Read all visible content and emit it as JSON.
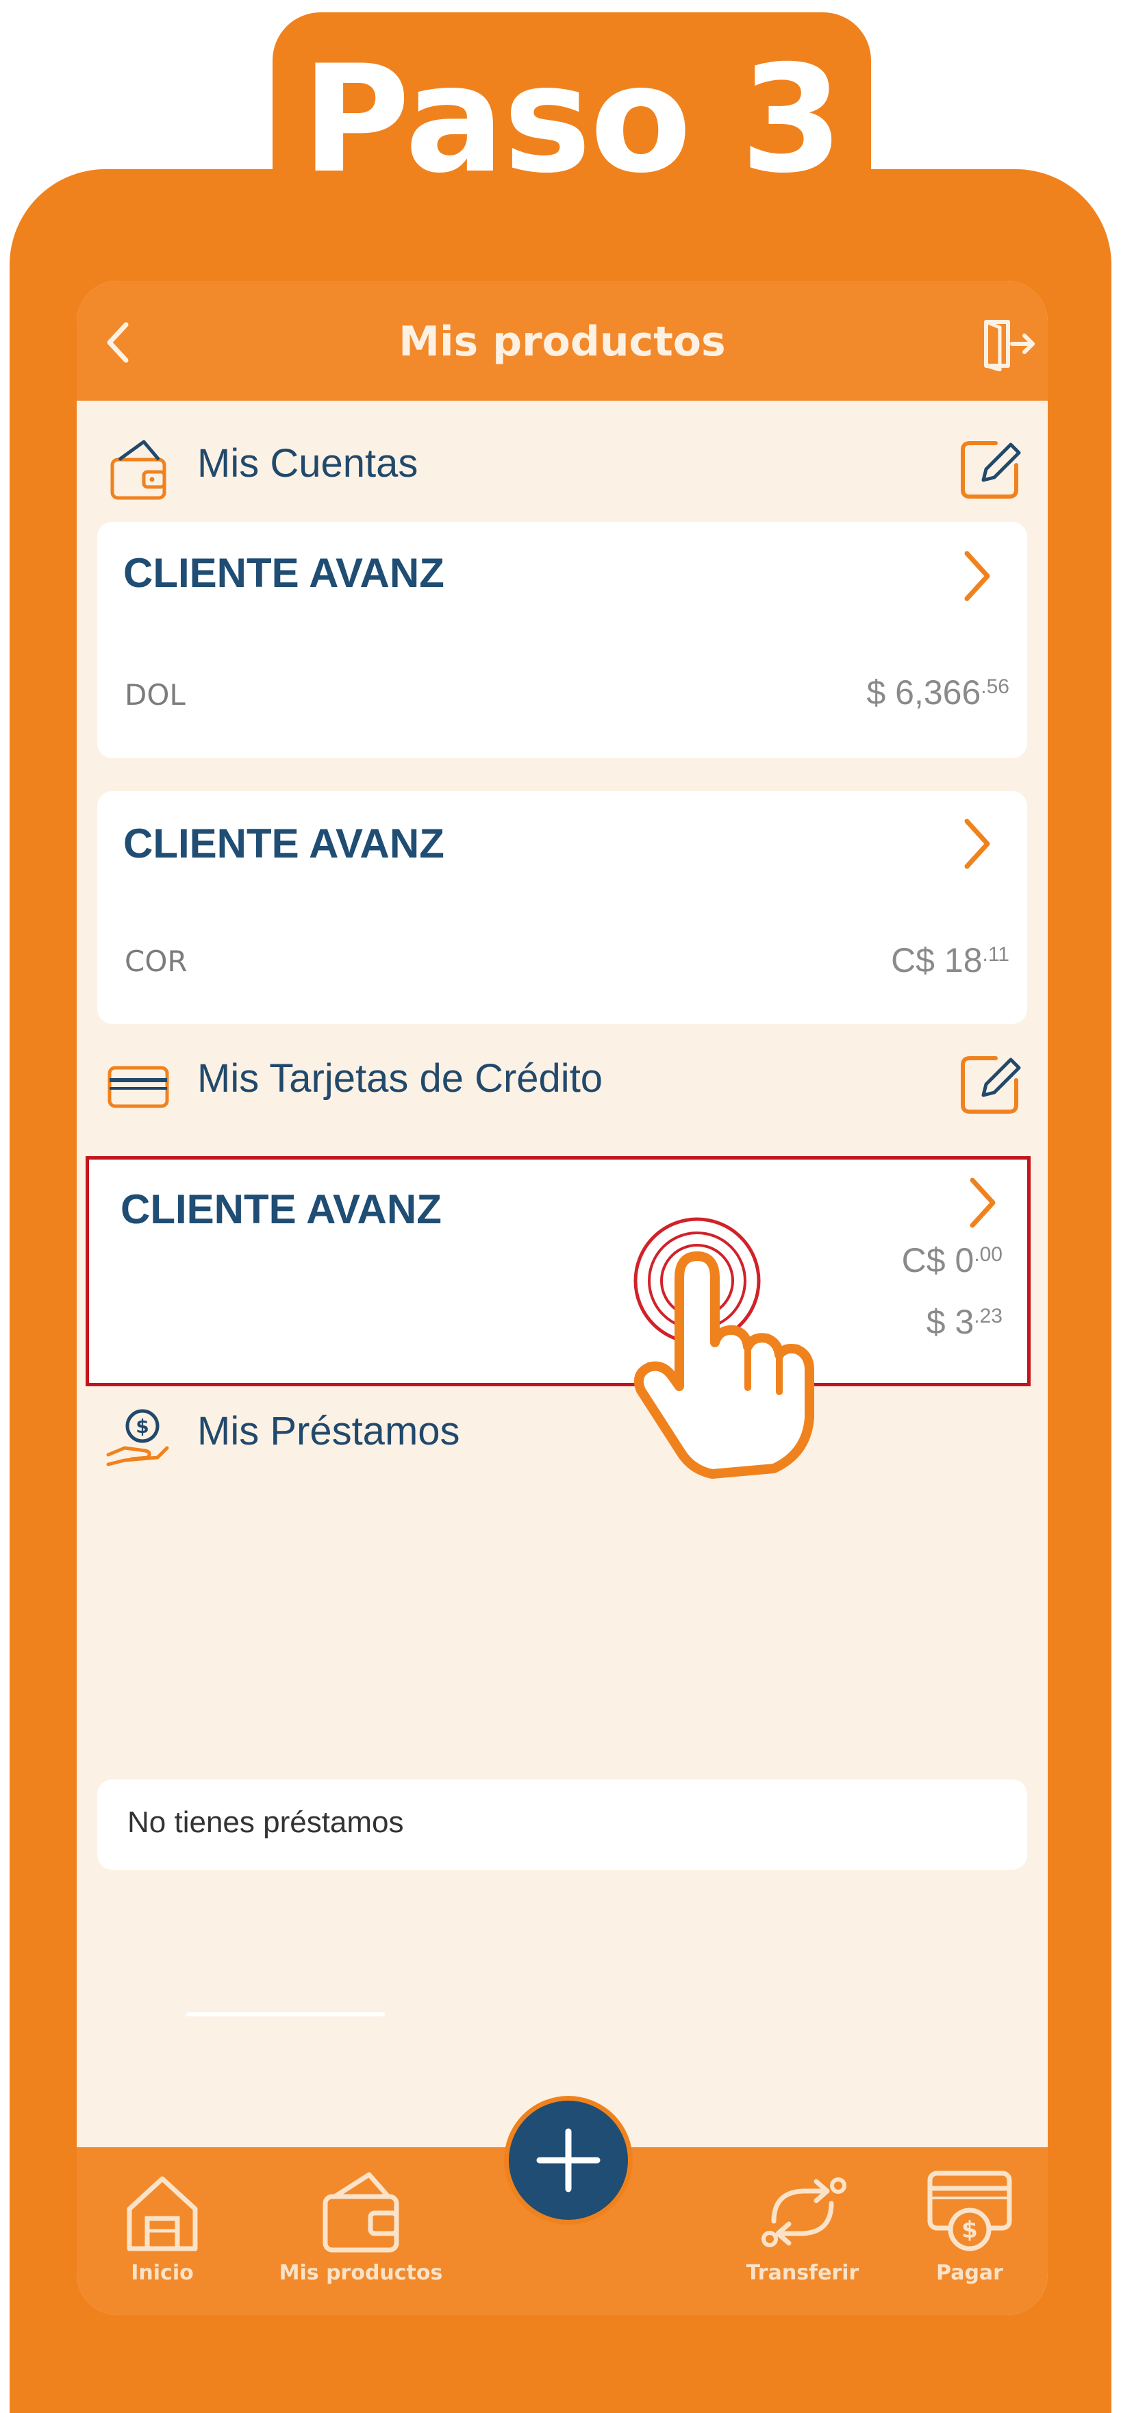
{
  "step": {
    "title": "Paso 3"
  },
  "header": {
    "title": "Mis productos",
    "back_icon": "chevron-left-icon",
    "logout_icon": "logout-icon"
  },
  "accounts": {
    "title": "Mis Cuentas",
    "items": [
      {
        "name": "CLIENTE AVANZ",
        "currency": "DOL",
        "amount": "$ 6,366",
        "cents": ".56"
      },
      {
        "name": "CLIENTE AVANZ",
        "currency": "COR",
        "amount": "C$ 18",
        "cents": ".11"
      }
    ]
  },
  "credit_cards": {
    "title": "Mis Tarjetas de Crédito",
    "items": [
      {
        "name": "CLIENTE AVANZ",
        "amount_cor": "C$ 0",
        "cents_cor": ".00",
        "amount_usd": "$ 3",
        "cents_usd": ".23"
      }
    ]
  },
  "loans": {
    "title": "Mis Préstamos",
    "empty_message": "No tienes préstamos"
  },
  "bottom_nav": {
    "items": [
      {
        "label": "Inicio",
        "icon": "home-icon"
      },
      {
        "label": "Mis productos",
        "icon": "wallet-icon"
      },
      {
        "label": "Transferir",
        "icon": "transfer-icon"
      },
      {
        "label": "Pagar",
        "icon": "pay-icon"
      }
    ],
    "fab_icon": "plus-icon"
  },
  "colors": {
    "orange": "#f0821e",
    "navy": "#1f4d73",
    "highlight": "#c2141c",
    "background": "#fcf1e5"
  }
}
